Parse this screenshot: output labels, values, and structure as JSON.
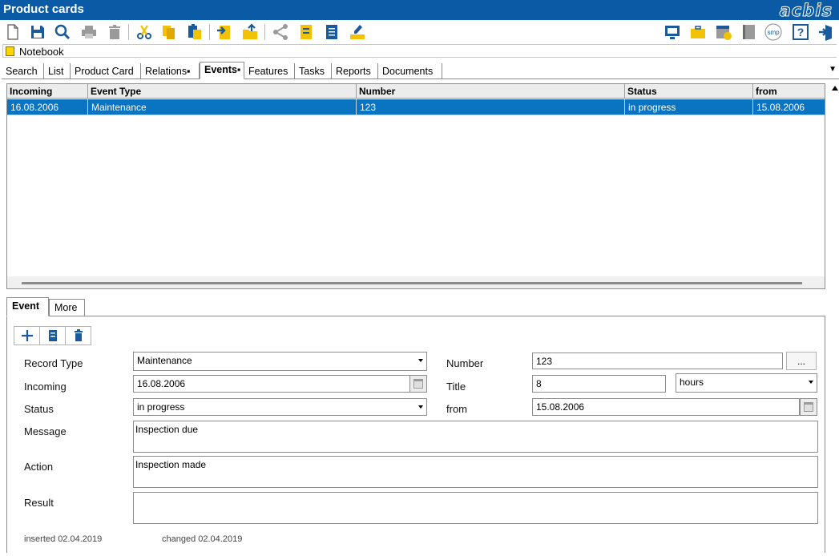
{
  "window": {
    "title": "Product cards",
    "logo": "acbis"
  },
  "toolbar": {
    "left_icons": [
      "new-document-icon",
      "save-icon",
      "search-icon",
      "print-icon",
      "delete-icon",
      "cut-icon",
      "copy-icon",
      "paste-icon",
      "export-icon",
      "import-icon",
      "share-icon",
      "card-icon",
      "list-document-icon",
      "highlight-icon"
    ],
    "right_icons": [
      "monitor-icon",
      "briefcase-icon",
      "calendar-check-icon",
      "book-icon",
      "smp-icon",
      "help-icon",
      "exit-icon"
    ],
    "smp_label": "smp",
    "help_label": "?"
  },
  "notebook": {
    "label": "Notebook"
  },
  "main_tabs": [
    "Search",
    "List",
    "Product Card",
    "Relations▪",
    "Events▪",
    "Features",
    "Tasks",
    "Reports",
    "Documents"
  ],
  "active_main_tab": "Events▪",
  "table": {
    "columns": [
      "Incoming",
      "Event Type",
      "Number",
      "Status",
      "from"
    ],
    "rows": [
      [
        "16.08.2006",
        "Maintenance",
        "123",
        "in progress",
        "15.08.2006"
      ]
    ]
  },
  "detail_tabs": [
    "Event",
    "More"
  ],
  "form": {
    "record_type_label": "Record Type",
    "record_type_value": "Maintenance",
    "incoming_label": "Incoming",
    "incoming_value": "16.08.2006",
    "status_label": "Status",
    "status_value": "in progress",
    "number_label": "Number",
    "number_value": "123",
    "number_button": "...",
    "title_label": "Title",
    "title_value": "8",
    "title_unit": "hours",
    "from_label": "from",
    "from_value": "15.08.2006",
    "message_label": "Message",
    "message_value": "Inspection due",
    "action_label": "Action",
    "action_value": "Inspection made",
    "result_label": "Result",
    "result_value": ""
  },
  "meta": {
    "inserted": "inserted  02.04.2019",
    "changed": "changed 02.04.2019"
  },
  "colors": {
    "titlebar": "#0a5aa6",
    "selection": "#0a73c2",
    "icon_yellow": "#f2c200",
    "icon_blue": "#1a5a9a"
  }
}
